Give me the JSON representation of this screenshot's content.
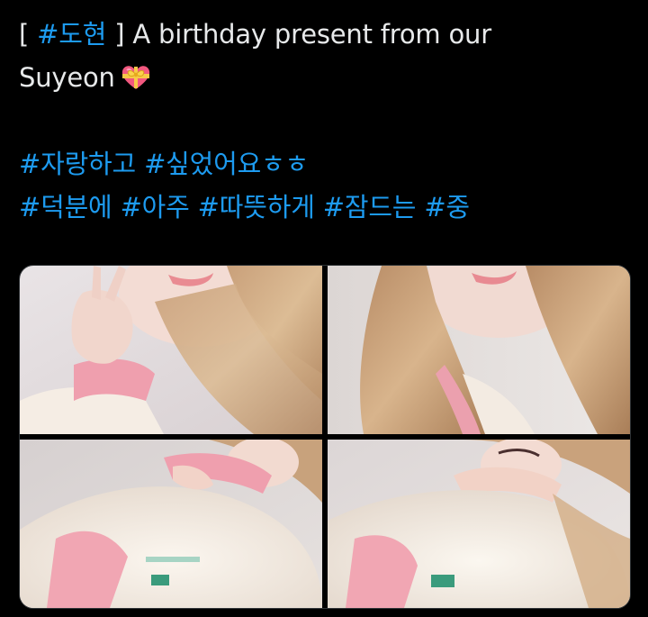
{
  "tweet": {
    "line1": {
      "open_bracket": "[ ",
      "hashtag": "#도현",
      "rest": " ] A birthday present from our"
    },
    "line2": {
      "text": "Suyeon",
      "emoji": "heart-with-ribbon-icon"
    },
    "hashtags_line1": [
      "#자랑하고",
      "#싶었어요ㅎㅎ"
    ],
    "hashtags_line2": [
      "#덕분에",
      "#아주",
      "#따뜻하게",
      "#잠드는",
      "#중"
    ]
  },
  "media": {
    "photo_count": 4
  },
  "colors": {
    "background": "#000000",
    "text": "#e7e9ea",
    "link": "#1d9bf0"
  }
}
